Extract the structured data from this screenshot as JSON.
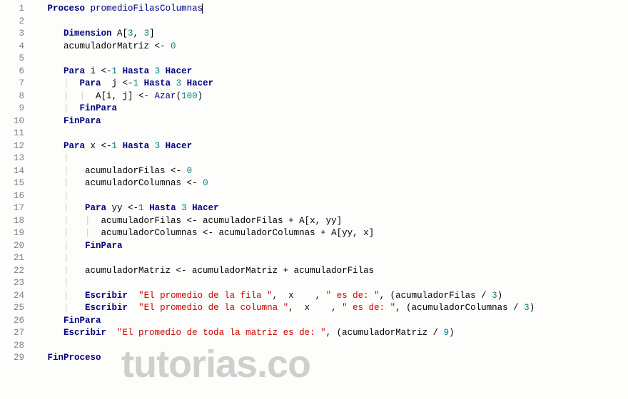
{
  "watermark": "tutorias.co",
  "lines": [
    {
      "n": 1,
      "segs": [
        [
          "txt",
          "   "
        ],
        [
          "kw",
          "Proceso"
        ],
        [
          "txt",
          " "
        ],
        [
          "ident-dark",
          "promedioFilasColumnas"
        ]
      ],
      "cursor": true
    },
    {
      "n": 2,
      "segs": [
        [
          "txt",
          "   "
        ]
      ]
    },
    {
      "n": 3,
      "segs": [
        [
          "txt",
          "      "
        ],
        [
          "kw",
          "Dimension"
        ],
        [
          "txt",
          " A["
        ],
        [
          "num",
          "3"
        ],
        [
          "txt",
          ", "
        ],
        [
          "num",
          "3"
        ],
        [
          "txt",
          "]"
        ]
      ]
    },
    {
      "n": 4,
      "segs": [
        [
          "txt",
          "      acumuladorMatriz <- "
        ],
        [
          "num",
          "0"
        ]
      ]
    },
    {
      "n": 5,
      "segs": [
        [
          "txt",
          "   "
        ]
      ]
    },
    {
      "n": 6,
      "segs": [
        [
          "txt",
          "      "
        ],
        [
          "kw",
          "Para"
        ],
        [
          "txt",
          " i <-"
        ],
        [
          "num",
          "1"
        ],
        [
          "txt",
          " "
        ],
        [
          "kw",
          "Hasta"
        ],
        [
          "txt",
          " "
        ],
        [
          "num",
          "3"
        ],
        [
          "txt",
          " "
        ],
        [
          "kw",
          "Hacer"
        ]
      ]
    },
    {
      "n": 7,
      "segs": [
        [
          "txt",
          "      "
        ],
        [
          "guide",
          "|  "
        ],
        [
          "kw",
          "Para"
        ],
        [
          "txt",
          "  j <-"
        ],
        [
          "num",
          "1"
        ],
        [
          "txt",
          " "
        ],
        [
          "kw",
          "Hasta"
        ],
        [
          "txt",
          " "
        ],
        [
          "num",
          "3"
        ],
        [
          "txt",
          " "
        ],
        [
          "kw",
          "Hacer"
        ]
      ]
    },
    {
      "n": 8,
      "segs": [
        [
          "txt",
          "      "
        ],
        [
          "guide",
          "|  |  "
        ],
        [
          "txt",
          "A[i, j] <- "
        ],
        [
          "ident-dark",
          "Azar"
        ],
        [
          "txt",
          "("
        ],
        [
          "num",
          "100"
        ],
        [
          "txt",
          ")"
        ]
      ]
    },
    {
      "n": 9,
      "segs": [
        [
          "txt",
          "      "
        ],
        [
          "guide",
          "|  "
        ],
        [
          "kw",
          "FinPara"
        ]
      ]
    },
    {
      "n": 10,
      "segs": [
        [
          "txt",
          "      "
        ],
        [
          "kw",
          "FinPara"
        ]
      ]
    },
    {
      "n": 11,
      "segs": [
        [
          "txt",
          "   "
        ]
      ]
    },
    {
      "n": 12,
      "segs": [
        [
          "txt",
          "      "
        ],
        [
          "kw",
          "Para"
        ],
        [
          "txt",
          " x <-"
        ],
        [
          "num",
          "1"
        ],
        [
          "txt",
          " "
        ],
        [
          "kw",
          "Hasta"
        ],
        [
          "txt",
          " "
        ],
        [
          "num",
          "3"
        ],
        [
          "txt",
          " "
        ],
        [
          "kw",
          "Hacer"
        ]
      ]
    },
    {
      "n": 13,
      "segs": [
        [
          "txt",
          "      "
        ],
        [
          "guide",
          "|"
        ]
      ]
    },
    {
      "n": 14,
      "segs": [
        [
          "txt",
          "      "
        ],
        [
          "guide",
          "|   "
        ],
        [
          "txt",
          "acumuladorFilas <- "
        ],
        [
          "num",
          "0"
        ]
      ]
    },
    {
      "n": 15,
      "segs": [
        [
          "txt",
          "      "
        ],
        [
          "guide",
          "|   "
        ],
        [
          "txt",
          "acumuladorColumnas <- "
        ],
        [
          "num",
          "0"
        ]
      ]
    },
    {
      "n": 16,
      "segs": [
        [
          "txt",
          "      "
        ],
        [
          "guide",
          "|"
        ]
      ]
    },
    {
      "n": 17,
      "segs": [
        [
          "txt",
          "      "
        ],
        [
          "guide",
          "|   "
        ],
        [
          "kw",
          "Para"
        ],
        [
          "txt",
          " yy <-"
        ],
        [
          "num",
          "1"
        ],
        [
          "txt",
          " "
        ],
        [
          "kw",
          "Hasta"
        ],
        [
          "txt",
          " "
        ],
        [
          "num",
          "3"
        ],
        [
          "txt",
          " "
        ],
        [
          "kw",
          "Hacer"
        ]
      ]
    },
    {
      "n": 18,
      "segs": [
        [
          "txt",
          "      "
        ],
        [
          "guide",
          "|   |  "
        ],
        [
          "txt",
          "acumuladorFilas <- acumuladorFilas + A[x, yy]"
        ]
      ]
    },
    {
      "n": 19,
      "segs": [
        [
          "txt",
          "      "
        ],
        [
          "guide",
          "|   |  "
        ],
        [
          "txt",
          "acumuladorColumnas <- acumuladorColumnas + A[yy, x]"
        ]
      ]
    },
    {
      "n": 20,
      "segs": [
        [
          "txt",
          "      "
        ],
        [
          "guide",
          "|   "
        ],
        [
          "kw",
          "FinPara"
        ]
      ]
    },
    {
      "n": 21,
      "segs": [
        [
          "txt",
          "      "
        ],
        [
          "guide",
          "|"
        ]
      ]
    },
    {
      "n": 22,
      "segs": [
        [
          "txt",
          "      "
        ],
        [
          "guide",
          "|   "
        ],
        [
          "txt",
          "acumuladorMatriz <- acumuladorMatriz + acumuladorFilas"
        ]
      ]
    },
    {
      "n": 23,
      "segs": [
        [
          "txt",
          "      "
        ],
        [
          "guide",
          "|"
        ]
      ]
    },
    {
      "n": 24,
      "segs": [
        [
          "txt",
          "      "
        ],
        [
          "guide",
          "|   "
        ],
        [
          "kw",
          "Escribir"
        ],
        [
          "txt",
          "  "
        ],
        [
          "str",
          "\"El promedio de la fila \""
        ],
        [
          "txt",
          ",  x    , "
        ],
        [
          "str",
          "\" es de: \""
        ],
        [
          "txt",
          ", (acumuladorFilas / "
        ],
        [
          "num",
          "3"
        ],
        [
          "txt",
          ")"
        ]
      ]
    },
    {
      "n": 25,
      "segs": [
        [
          "txt",
          "      "
        ],
        [
          "guide",
          "|   "
        ],
        [
          "kw",
          "Escribir"
        ],
        [
          "txt",
          "  "
        ],
        [
          "str",
          "\"El promedio de la columna \""
        ],
        [
          "txt",
          ",  x    , "
        ],
        [
          "str",
          "\" es de: \""
        ],
        [
          "txt",
          ", (acumuladorColumnas / "
        ],
        [
          "num",
          "3"
        ],
        [
          "txt",
          ")"
        ]
      ]
    },
    {
      "n": 26,
      "segs": [
        [
          "txt",
          "      "
        ],
        [
          "kw",
          "FinPara"
        ]
      ]
    },
    {
      "n": 27,
      "segs": [
        [
          "txt",
          "      "
        ],
        [
          "kw",
          "Escribir"
        ],
        [
          "txt",
          "  "
        ],
        [
          "str",
          "\"El promedio de toda la matriz es de: \""
        ],
        [
          "txt",
          ", (acumuladorMatriz / "
        ],
        [
          "num",
          "9"
        ],
        [
          "txt",
          ")"
        ]
      ]
    },
    {
      "n": 28,
      "segs": [
        [
          "txt",
          "   "
        ]
      ]
    },
    {
      "n": 29,
      "segs": [
        [
          "txt",
          "   "
        ],
        [
          "kw",
          "FinProceso"
        ]
      ]
    }
  ]
}
